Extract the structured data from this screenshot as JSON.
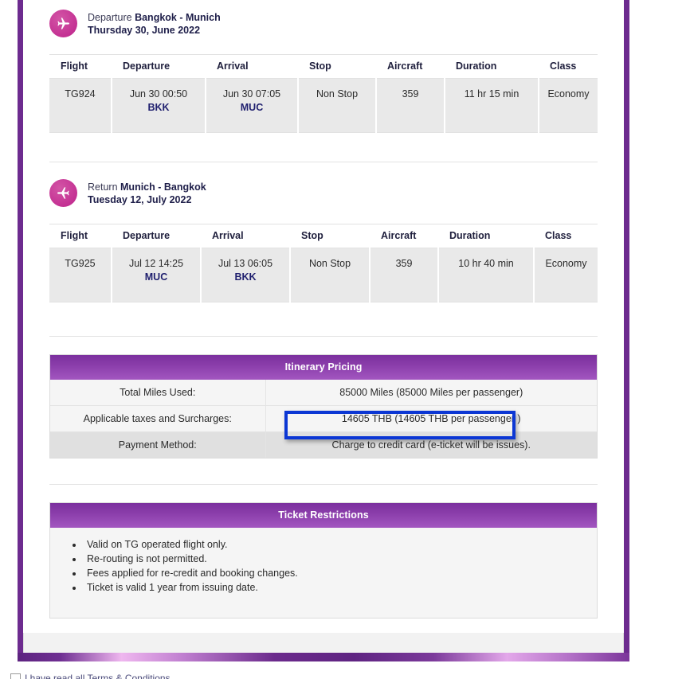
{
  "theme": {
    "border_purple": "#6d2b8f",
    "icon_pink": "#c43193",
    "panel_purple": "#8a3daa",
    "highlight_blue": "#0c37d4",
    "airport_code_color": "#1f1f6e"
  },
  "legs": [
    {
      "icon": "airplane-right-icon",
      "label": "Departure",
      "route": "Bangkok - Munich",
      "date": "Thursday 30, June 2022",
      "columns": [
        "Flight",
        "Departure",
        "Arrival",
        "Stop",
        "Aircraft",
        "Duration",
        "Class"
      ],
      "row": {
        "flight": "TG924",
        "departure_time": "Jun 30 00:50",
        "departure_airport": "BKK",
        "arrival_time": "Jun 30 07:05",
        "arrival_airport": "MUC",
        "stop": "Non Stop",
        "aircraft": "359",
        "duration": "11 hr 15 min",
        "class": "Economy"
      }
    },
    {
      "icon": "airplane-left-icon",
      "label": "Return",
      "route": "Munich - Bangkok",
      "date": "Tuesday 12, July 2022",
      "columns": [
        "Flight",
        "Departure",
        "Arrival",
        "Stop",
        "Aircraft",
        "Duration",
        "Class"
      ],
      "row": {
        "flight": "TG925",
        "departure_time": "Jul 12 14:25",
        "departure_airport": "MUC",
        "arrival_time": "Jul 13 06:05",
        "arrival_airport": "BKK",
        "stop": "Non Stop",
        "aircraft": "359",
        "duration": "10 hr 40 min",
        "class": "Economy"
      }
    }
  ],
  "pricing": {
    "title": "Itinerary Pricing",
    "rows": [
      {
        "key": "Total Miles Used:",
        "value": "85000 Miles (85000 Miles per passenger)"
      },
      {
        "key": "Applicable taxes and Surcharges:",
        "value": "14605 THB (14605 THB per passenger )"
      },
      {
        "key": "Payment Method:",
        "value": "Charge to credit card (e-ticket will be issues)."
      }
    ]
  },
  "restrictions": {
    "title": "Ticket Restrictions",
    "items": [
      "Valid on TG operated flight only.",
      "Re-routing is not permitted.",
      "Fees applied for re-credit and booking changes.",
      "Ticket is valid 1 year from issuing date."
    ]
  },
  "terms": {
    "label": "I have read all Terms & Conditions"
  }
}
